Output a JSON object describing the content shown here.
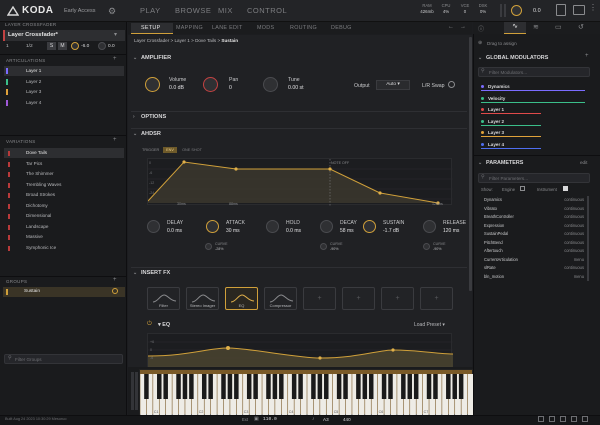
{
  "app": {
    "name": "KODA",
    "edition": "Early Access"
  },
  "nav": [
    "PLAY",
    "BROWSE",
    "MIX",
    "CONTROL"
  ],
  "stats": [
    {
      "label": "RAM",
      "value": "426mb"
    },
    {
      "label": "CPU",
      "value": "4%"
    },
    {
      "label": "VCE",
      "value": "0"
    },
    {
      "label": "DSK",
      "value": "0%"
    }
  ],
  "master_volume": "0.0",
  "left": {
    "crossfader_header": "LAYER CROSSFADER",
    "crossfader_name": "Layer Crossfader*",
    "controls": {
      "voice_index": "1",
      "channel": "1/2",
      "solo": "S",
      "mute": "M",
      "gain": "-6.0",
      "pan": "0.0"
    },
    "articulations_title": "ARTICULATIONS",
    "articulations": [
      {
        "label": "Layer 1",
        "color": "#7b6cff"
      },
      {
        "label": "Layer 2",
        "color": "#3bbf8a"
      },
      {
        "label": "Layer 3",
        "color": "#e0a23a"
      },
      {
        "label": "Layer 4",
        "color": "#a058d8"
      }
    ],
    "variations_title": "VARIATIONS",
    "variations": [
      "Dove Tails",
      "Tar Pics",
      "The Shimmer",
      "Trembling Waves",
      "Broad Strokes",
      "Dichotomy",
      "Dimensional",
      "Landscape",
      "Massive",
      "Symphonic Ice"
    ],
    "groups_title": "GROUPS",
    "groups": [
      "Sustain"
    ],
    "filter_groups_placeholder": "Filter Groups"
  },
  "tabs": [
    "SETUP",
    "MAPPING",
    "LANE EDIT",
    "MODS",
    "ROUTING",
    "DEBUG"
  ],
  "breadcrumb": [
    "Layer Crossfader",
    "Layer 1",
    "Dove Tails",
    "Sustain"
  ],
  "amplifier": {
    "title": "AMPLIFIER",
    "volume": {
      "label": "Volume",
      "value": "0.0 dB"
    },
    "pan": {
      "label": "Pan",
      "value": "0"
    },
    "tune": {
      "label": "Tune",
      "value": "0.00 st"
    },
    "output_label": "Output",
    "output_value": "Auto",
    "lr_swap": "L/R Swap"
  },
  "options_title": "OPTIONS",
  "ahdsr": {
    "title": "AHDSR",
    "trigger_label": "TRIGGER",
    "trigger_options": [
      "ENV",
      "ONE SHOT"
    ],
    "y_ticks": [
      "0",
      "-6",
      "-12",
      "-24",
      "-48"
    ],
    "x_ticks": [
      "30ms",
      "88ms",
      "120ms"
    ],
    "note_off": "NOTE OFF",
    "params": [
      {
        "label": "DELAY",
        "value": "0.0 ms"
      },
      {
        "label": "ATTACK",
        "value": "30 ms"
      },
      {
        "label": "HOLD",
        "value": "0.0 ms"
      },
      {
        "label": "DECAY",
        "value": "58 ms"
      },
      {
        "label": "SUSTAIN",
        "value": "-1.7 dB"
      },
      {
        "label": "RELEASE",
        "value": "120 ms"
      }
    ],
    "curves": [
      {
        "label": "CURVE",
        "value": "-28%"
      },
      {
        "label": "CURVE",
        "value": "-90%"
      },
      {
        "label": "CURVE",
        "value": "-90%"
      }
    ]
  },
  "insert_fx": {
    "title": "INSERT FX",
    "slots": [
      "Filter",
      "Stereo Imager",
      "EQ",
      "Compressor"
    ],
    "eq_title": "EQ",
    "load_preset": "Load Preset",
    "eq_y_ticks": [
      "+6",
      "0",
      "-6",
      "-12"
    ]
  },
  "piano": {
    "octave_labels": [
      "C1",
      "C2",
      "C3",
      "C4",
      "C5",
      "C6",
      "C7"
    ]
  },
  "bottom": {
    "build": "Built Aug 24 2023 10:30:29 Mesoruo",
    "ext": "Ext",
    "tempo": "110.0",
    "pitch_label": "A3",
    "pitch_hz": "440"
  },
  "right": {
    "drag_label": "Drag to assign",
    "global_mods_title": "GLOBAL MODULATORS",
    "filter_mods_placeholder": "Filter Modulators...",
    "modulators": [
      {
        "label": "Dynamics",
        "color": "#7b6cff"
      },
      {
        "label": "Velocity",
        "color": "#3bbf8a"
      },
      {
        "label": "Layer 1",
        "color": "#e04a4a"
      },
      {
        "label": "Layer 2",
        "color": "#3bbf8a"
      },
      {
        "label": "Layer 3",
        "color": "#e0a23a"
      },
      {
        "label": "Layer 4",
        "color": "#4f6ef0"
      }
    ],
    "params_title": "PARAMETERS",
    "edit": "edit",
    "filter_params_placeholder": "Filter Parameters...",
    "show_label": "Show:",
    "show_engine": "Engine",
    "show_instrument": "Instrument",
    "params": [
      {
        "name": "Dynamics",
        "mode": "continuous"
      },
      {
        "name": "Vibrato",
        "mode": "continuous"
      },
      {
        "name": "BreathController",
        "mode": "continuous"
      },
      {
        "name": "Expression",
        "mode": "continuous"
      },
      {
        "name": "SustainPedal",
        "mode": "continuous"
      },
      {
        "name": "PitchBend",
        "mode": "continuous"
      },
      {
        "name": "Aftertouch",
        "mode": "continuous"
      },
      {
        "name": "CurrentArticulation",
        "mode": "menu"
      },
      {
        "name": "slRate",
        "mode": "continuous"
      },
      {
        "name": "bln_motion",
        "mode": "menu"
      }
    ]
  }
}
